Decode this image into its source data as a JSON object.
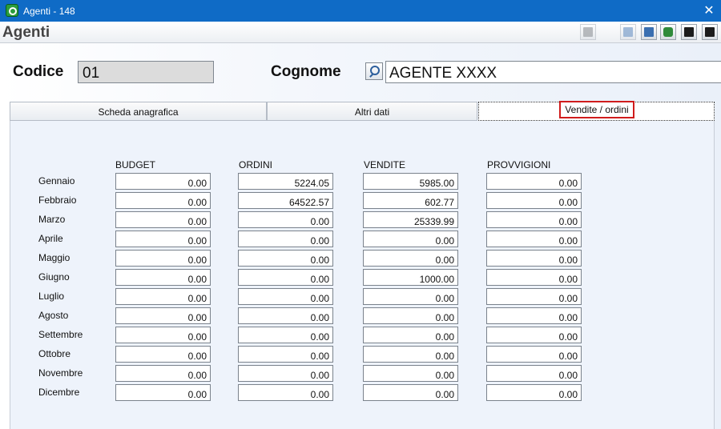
{
  "window": {
    "title": "Agenti - 148",
    "close_glyph": "✕"
  },
  "toolbar": {
    "heading": "Agenti",
    "buttons": [
      {
        "name": "list-icon",
        "enabled": false
      },
      {
        "name": "edit-icon",
        "enabled": false
      },
      {
        "name": "copy-icon",
        "enabled": true
      },
      {
        "name": "recycle-icon",
        "enabled": true
      },
      {
        "name": "save-icon",
        "enabled": true
      },
      {
        "name": "exit-icon",
        "enabled": true
      }
    ]
  },
  "form": {
    "codice_label": "Codice",
    "codice_value": "01",
    "cognome_label": "Cognome",
    "cognome_value": "AGENTE XXXX"
  },
  "tabs": [
    {
      "label": "Scheda anagrafica"
    },
    {
      "label": "Altri dati"
    },
    {
      "label": "Vendite / ordini",
      "active": true
    }
  ],
  "table": {
    "headers": [
      "BUDGET",
      "ORDINI",
      "VENDITE",
      "PROVVIGIONI"
    ],
    "months": [
      "Gennaio",
      "Febbraio",
      "Marzo",
      "Aprile",
      "Maggio",
      "Giugno",
      "Luglio",
      "Agosto",
      "Settembre",
      "Ottobre",
      "Novembre",
      "Dicembre"
    ],
    "rows": [
      [
        "0.00",
        "5224.05",
        "5985.00",
        "0.00"
      ],
      [
        "0.00",
        "64522.57",
        "602.77",
        "0.00"
      ],
      [
        "0.00",
        "0.00",
        "25339.99",
        "0.00"
      ],
      [
        "0.00",
        "0.00",
        "0.00",
        "0.00"
      ],
      [
        "0.00",
        "0.00",
        "0.00",
        "0.00"
      ],
      [
        "0.00",
        "0.00",
        "1000.00",
        "0.00"
      ],
      [
        "0.00",
        "0.00",
        "0.00",
        "0.00"
      ],
      [
        "0.00",
        "0.00",
        "0.00",
        "0.00"
      ],
      [
        "0.00",
        "0.00",
        "0.00",
        "0.00"
      ],
      [
        "0.00",
        "0.00",
        "0.00",
        "0.00"
      ],
      [
        "0.00",
        "0.00",
        "0.00",
        "0.00"
      ],
      [
        "0.00",
        "0.00",
        "0.00",
        "0.00"
      ]
    ]
  }
}
